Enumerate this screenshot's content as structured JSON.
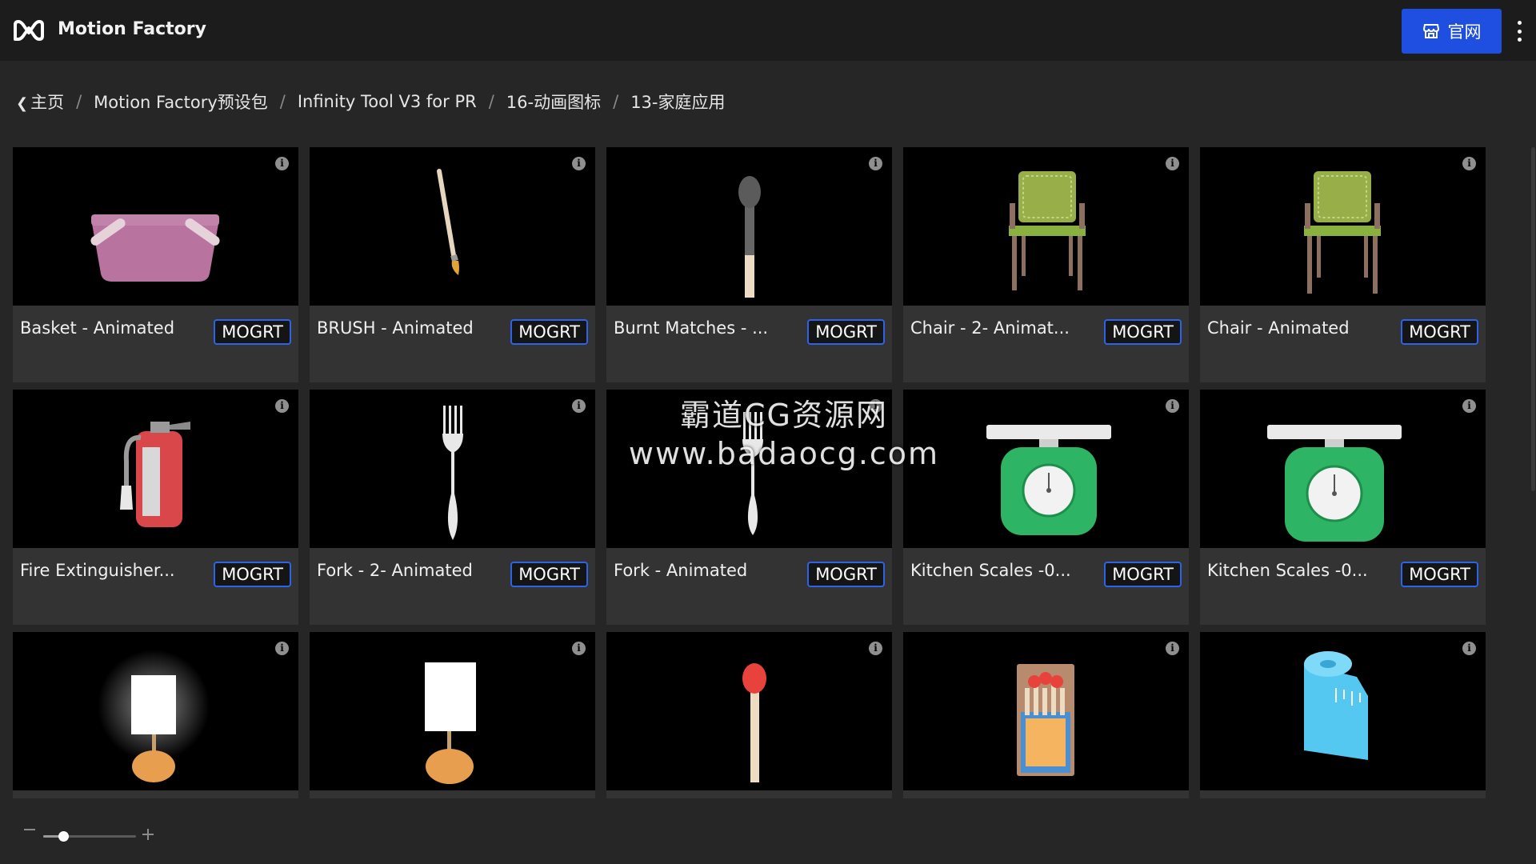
{
  "app": {
    "title": "Motion Factory",
    "logo_icon": "infinity-logo-icon",
    "official_button_label": "官网",
    "official_button_icon": "storefront-icon",
    "menu_icon": "kebab-menu-icon",
    "accent_color": "#1f4fe0"
  },
  "breadcrumb": {
    "items": [
      {
        "label": "主页",
        "icon": "chevron-left-icon"
      },
      {
        "label": "Motion Factory预设包"
      },
      {
        "label": "Infinity Tool V3 for PR"
      },
      {
        "label": "16-动画图标"
      },
      {
        "label": "13-家庭应用"
      }
    ],
    "separator": "/"
  },
  "grid": {
    "badge_label": "MOGRT",
    "items": [
      {
        "title": "Basket - Animated",
        "icon": "basket-icon"
      },
      {
        "title": "BRUSH - Animated",
        "icon": "paintbrush-icon"
      },
      {
        "title": "Burnt Matches - ...",
        "icon": "burnt-match-icon"
      },
      {
        "title": "Chair - 2- Animat...",
        "icon": "chair-icon"
      },
      {
        "title": "Chair - Animated",
        "icon": "chair-icon"
      },
      {
        "title": "Fire Extinguisher...",
        "icon": "fire-extinguisher-icon"
      },
      {
        "title": "Fork - 2- Animated",
        "icon": "fork-icon"
      },
      {
        "title": "Fork - Animated",
        "icon": "fork-icon"
      },
      {
        "title": "Kitchen Scales -0...",
        "icon": "kitchen-scale-icon"
      },
      {
        "title": "Kitchen Scales -0...",
        "icon": "kitchen-scale-icon"
      },
      {
        "title": "",
        "icon": "lamp-lit-icon"
      },
      {
        "title": "",
        "icon": "lamp-icon"
      },
      {
        "title": "",
        "icon": "match-icon"
      },
      {
        "title": "",
        "icon": "matchbox-icon"
      },
      {
        "title": "",
        "icon": "measuring-tape-icon"
      }
    ]
  },
  "watermark": {
    "line1": "霸道CG资源网",
    "line2": "www.badaocg.com"
  },
  "zoom": {
    "minus_icon": "minus-icon",
    "plus_icon": "plus-icon",
    "level": 0.2
  }
}
